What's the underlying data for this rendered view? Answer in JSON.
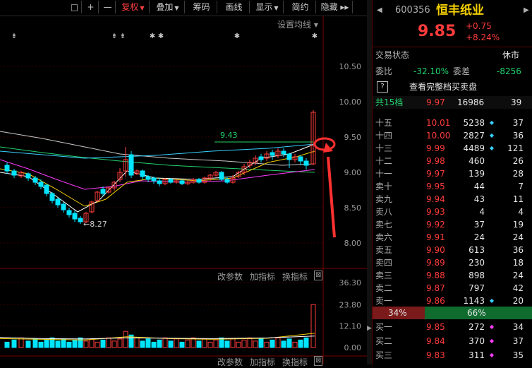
{
  "toolbar": {
    "buttons": [
      "□",
      "+",
      "—",
      "复权",
      "叠加",
      "筹码",
      "画线",
      "显示",
      "简约",
      "隐藏 ▸▸"
    ],
    "active": "复权"
  },
  "main_chart": {
    "settings_label": "设置均线 ▾",
    "y_ticks": [
      "10.50",
      "10.00",
      "9.50",
      "9.00",
      "8.50",
      "8.00"
    ],
    "high_label": "9.43",
    "low_label": "8.27",
    "colors": {
      "up": "#ff3b3b",
      "down": "#00e5ff",
      "ma5": "#ffffff",
      "ma10": "#f5d000",
      "ma20": "#ff3cff",
      "ma60": "#22d36b",
      "ma_long": "#39d0ff"
    }
  },
  "volume_pane": {
    "buttons": [
      "改参数",
      "加指标",
      "换指标",
      "⊠"
    ],
    "y_ticks": [
      "36.30",
      "23.80",
      "12.10",
      "0.00"
    ]
  },
  "bottom_pane": {
    "buttons": [
      "改参数",
      "加指标",
      "换指标",
      "⊠"
    ]
  },
  "quote": {
    "code": "600356",
    "name": "恒丰纸业",
    "price": "9.85",
    "change": "+0.75",
    "change_pct": "+8.24%",
    "trade_status_label": "交易状态",
    "trade_status": "休市",
    "weibi_label": "委比",
    "weibi": "-32.10%",
    "weicha_label": "委差",
    "weicha": "-8256",
    "full_book_label": "查看完整档买卖盘",
    "total_label": "共15档",
    "total_price": "9.97",
    "total_vol": "16986",
    "total_orders": "39",
    "sell_levels": [
      {
        "label": "十五",
        "price": "10.01",
        "vol": "5238",
        "orders": "37"
      },
      {
        "label": "十四",
        "price": "10.00",
        "vol": "2827",
        "orders": "36"
      },
      {
        "label": "十三",
        "price": "9.99",
        "vol": "4489",
        "orders": "121"
      },
      {
        "label": "十二",
        "price": "9.98",
        "vol": "460",
        "orders": "26"
      },
      {
        "label": "十一",
        "price": "9.97",
        "vol": "139",
        "orders": "28"
      },
      {
        "label": "卖十",
        "price": "9.95",
        "vol": "44",
        "orders": "7"
      },
      {
        "label": "卖九",
        "price": "9.94",
        "vol": "43",
        "orders": "11"
      },
      {
        "label": "卖八",
        "price": "9.93",
        "vol": "4",
        "orders": "4"
      },
      {
        "label": "卖七",
        "price": "9.92",
        "vol": "37",
        "orders": "19"
      },
      {
        "label": "卖六",
        "price": "9.91",
        "vol": "24",
        "orders": "24"
      },
      {
        "label": "卖五",
        "price": "9.90",
        "vol": "613",
        "orders": "36"
      },
      {
        "label": "卖四",
        "price": "9.89",
        "vol": "230",
        "orders": "18"
      },
      {
        "label": "卖三",
        "price": "9.88",
        "vol": "898",
        "orders": "24"
      },
      {
        "label": "卖二",
        "price": "9.87",
        "vol": "797",
        "orders": "42"
      },
      {
        "label": "卖一",
        "price": "9.86",
        "vol": "1143",
        "orders": "20"
      }
    ],
    "ratio_buy": "34%",
    "ratio_sell": "66%",
    "buy_levels": [
      {
        "label": "买一",
        "price": "9.85",
        "vol": "272",
        "orders": "34"
      },
      {
        "label": "买二",
        "price": "9.84",
        "vol": "370",
        "orders": "37"
      },
      {
        "label": "买三",
        "price": "9.83",
        "vol": "311",
        "orders": "35"
      }
    ]
  }
}
